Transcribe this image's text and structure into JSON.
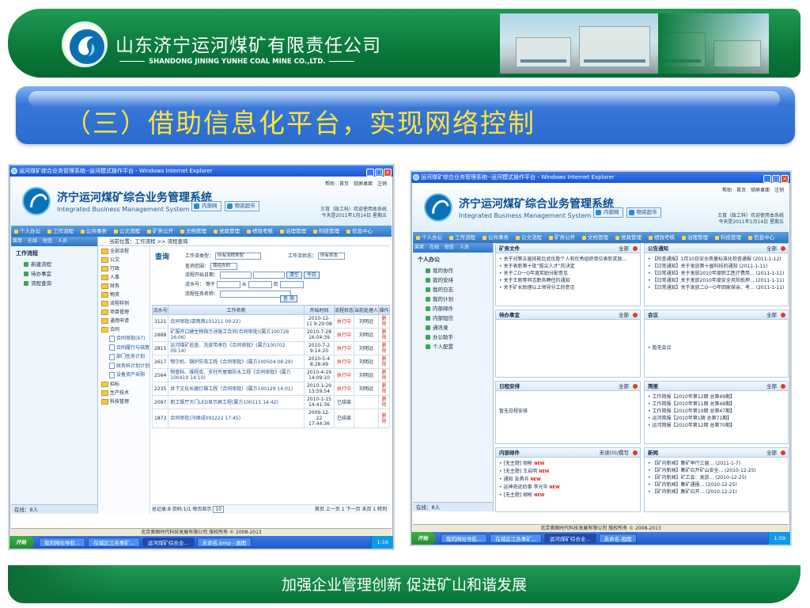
{
  "banner": {
    "company_cn": "山东济宁运河煤矿有限责任公司",
    "company_en": "SHANDONG JINING YUNHE COAL MINE CO.,LTD."
  },
  "slide": {
    "title": "（三）借助信息化平台，实现网络控制",
    "slogan": "加强企业管理创新 促进矿山和谐发展"
  },
  "colors": {
    "banner_green": "#0b7a3c",
    "title_blue": "#2a6bcf",
    "title_yellow": "#ffe33d"
  },
  "left_window": {
    "window_title": "运河煤矿综合业务管理系统--运河模式操作平台 - Windows Internet Explorer",
    "app_name": "济宁运河煤矿综合业务管理系统",
    "app_name_en": "Integrated Business Management System",
    "badges": [
      "内部网",
      "物资超市"
    ],
    "top_links": [
      "帮助",
      "首页",
      "锁屏桌面",
      "注销"
    ],
    "user_line1": "王育（政工科）欢迎使用本系统",
    "user_line2": "今天是2011年1月14日 星期五",
    "nav": [
      "个人办公",
      "工作流程",
      "公共事务",
      "公文流程",
      "矿务公开",
      "文档管理",
      "党政管理",
      "绩效考核",
      "治理管理",
      "科技管理",
      "信息中心"
    ],
    "side_tabs": [
      "菜单",
      "在线",
      "短信",
      "人员"
    ],
    "side_head": "工作流程",
    "side_items": [
      "新建流程",
      "待办事宜",
      "流程查询"
    ],
    "online": "在线：8人",
    "breadcrumb": "当前位置：工作流程 >> 流程查询",
    "tree_folders": [
      "全部流程",
      "公文",
      "行政",
      "人事",
      "财务",
      "物资",
      "流程样例",
      "项目管理",
      "通用申请",
      "合同"
    ],
    "tree_subs": [
      "合同审批(67)",
      "合同履行与结算",
      "部门任务计划",
      "财务科计划计划",
      "设备资产采购"
    ],
    "tree_folders2": [
      "招标",
      "生产技术",
      "科技管理"
    ],
    "query": {
      "title": "查询",
      "type_label": "工作流类型：",
      "type_value": "所有流程类型",
      "status_label": "工作流状态：",
      "status_value": "所有状态",
      "scope_label": "查询范围：",
      "scope_value": "我经办的",
      "start_label": "流程开始日期：",
      "clear_btn": "清空",
      "today_btn": "今日",
      "id_label": "流水号：",
      "eq": "等于",
      "from": "从",
      "to": "到",
      "name_label": "流程任务名称：",
      "search_btn": "查 询"
    },
    "table": {
      "headers": [
        "流水号",
        "工作名称",
        "开始时间",
        "流程状态",
        "当前处理人",
        "操作"
      ],
      "rows": [
        [
          "3121",
          "合同审批(邵燕燕101211 09:22)",
          "2010-12-11 9:20:08",
          "执行中",
          "刘明远",
          "删除"
        ],
        [
          "2888",
          "矿服开口建生物指示池施工合同(合同审批)(属方100728 16:06)",
          "2010-7-28 16:04:39",
          "执行中",
          "刘明远",
          "删除"
        ],
        [
          "2815",
          "运河煤矿巡查、洗皮带承包《合同审批》(属方100702 09:14)",
          "2010-7-2 9:14:20",
          "执行中",
          "刘明远",
          "删除"
        ],
        [
          "2617",
          "鄂尔机、锅炉防虫工程《合同审批》(属方100504 08:29)",
          "2010-5-4 8:28:49",
          "执行中",
          "刘明远",
          "删除"
        ],
        [
          "2564",
          "物管科、维程库、支柱所屋面防水工程《合同审批》(属方100419 14:10)",
          "2010-4-19 14:09:10",
          "执行中",
          "刘明远",
          "删除"
        ],
        [
          "2235",
          "井下文化长廊灯箱工程（合同审批）(属方100129 14:01)",
          "2010-1-29 13:59:54",
          "执行中",
          "刘明远",
          "删除"
        ],
        [
          "2097",
          "职工餐厅大门LED显示屏工程(属方100115 14:42)",
          "2010-1-15 14:41:36",
          "已结束",
          "",
          "删除"
        ],
        [
          "1873",
          "合同审批(冯继成091222 17:45)",
          "2009-12-22 17:44:36",
          "已结束",
          "",
          "删除"
        ]
      ]
    },
    "pager_left": "总记录:8 页码:1/1 每页显示",
    "pager_size": "10",
    "pager_right": "首页 上一页 1 下一页 末页 1 转到",
    "status_text": "北京奥图时代科技发展有限公司 版权所有 © 2008-2013",
    "taskbar_start": "开始",
    "taskbar_tasks": [
      "我的网址导航...",
      "在城区江各事矿...",
      "运河煤矿综合业...",
      "未命名.bmp - 画图"
    ],
    "tray_time": "1:16"
  },
  "right_window": {
    "window_title": "运河煤矿综合业务管理系统--运河模式操作平台 - Windows Internet Explorer",
    "app_name": "济宁运河煤矿综合业务管理系统",
    "app_name_en": "Integrated Business Management System",
    "badges": [
      "内部网",
      "物资超市"
    ],
    "top_links": [
      "帮助",
      "首页",
      "锁屏桌面",
      "注销"
    ],
    "user_line1": "王育（政工科）欢迎使用本系统",
    "user_line2": "今天是2011年1月14日 星期五",
    "nav": [
      "个人办公",
      "工作流程",
      "公共事务",
      "公文流程",
      "矿务公开",
      "文档管理",
      "党政管理",
      "绩效考核",
      "治理管理",
      "科技管理",
      "信息中心"
    ],
    "side_tabs": [
      "菜单",
      "在线",
      "短信",
      "人员"
    ],
    "side_head": "个人办公",
    "side_items": [
      "我的协作",
      "我的安排",
      "我的日志",
      "我的计划",
      "内部邮件",
      "内部短信",
      "通讯录",
      "办公助手",
      "个人配置"
    ],
    "online": "在线：8人",
    "panels": {
      "kuangwu": {
        "title": "矿务文件",
        "more": "全部",
        "items": [
          "关于对第五届技能比武优胜个人和优秀组织单位表彰奖励...",
          "关于表彰第十批“拔尖人才”的决定",
          "关于二O一O年度奖励分配意见",
          "关于王刚等同志职务聘任的通知",
          "关于矿长助理以上领导分工的意见"
        ]
      },
      "gonggao": {
        "title": "公告通知",
        "more": "全部",
        "items": [
          "【检查通报】1月10日安全质量标准化检查通报 (2011-1-12)",
          "【日常通知】关于发放第十届科技的通知 (2011-1-11)",
          "【日常通知】关于发放2010年度职工医疗费用... (2011-1-11)",
          "【日常通知】关于发放2010年度安全风险抵押... (2011-1-11)",
          "【日常通知】关于发放二O一O年回家探亲、考... (2011-1-11)"
        ]
      },
      "daiban": {
        "title": "待办事宜",
        "more": "全部",
        "items": []
      },
      "huiyi": {
        "title": "会议",
        "more": "全部",
        "empty": "暂无会议"
      },
      "richeng": {
        "title": "日程安排",
        "more": "全部",
        "empty": "暂无日程安排"
      },
      "jianbao": {
        "title": "简报",
        "more": "全部",
        "items": [
          "工作简报【2010年第12期 总第49期】",
          "工作简报【2010年第11期 总第48期】",
          "工作简报【2010年第10期 总第47期】",
          "运河简报【2010年第1期 总第71期】",
          "运河简报【2010年第12期 总第70期】"
        ]
      },
      "youjian": {
        "title": "内部邮件",
        "more": "未读(0)/撰写",
        "items": [
          "[无主题] 胡彬",
          "[无主题] 王启明",
          "通知 张勇兵",
          "运神奇迹后事 李光华",
          "[无主题] 胡彬"
        ]
      },
      "xinwen": {
        "title": "新闻",
        "more": "全部",
        "items": [
          "【矿内新闻】集矿举行三届... (2011-1-7)",
          "【矿内新闻】集矿召开矿山安全... (2010-12-25)",
          "【矿内新闻】矿工会：发放... (2010-12-25)",
          "【矿内新闻】集矿通报... (2010-12-25)",
          "【矿内新闻】集矿召开... (2010-12-21)"
        ]
      }
    },
    "status_text": "北京奥图时代科技发展有限公司 版权所有 © 2008-2013",
    "taskbar_start": "开始",
    "taskbar_tasks": [
      "我的网址导航...",
      "在城区江各事矿...",
      "运河煤矿综合业...",
      "未命名-画图"
    ],
    "tray_time": "1:09"
  }
}
